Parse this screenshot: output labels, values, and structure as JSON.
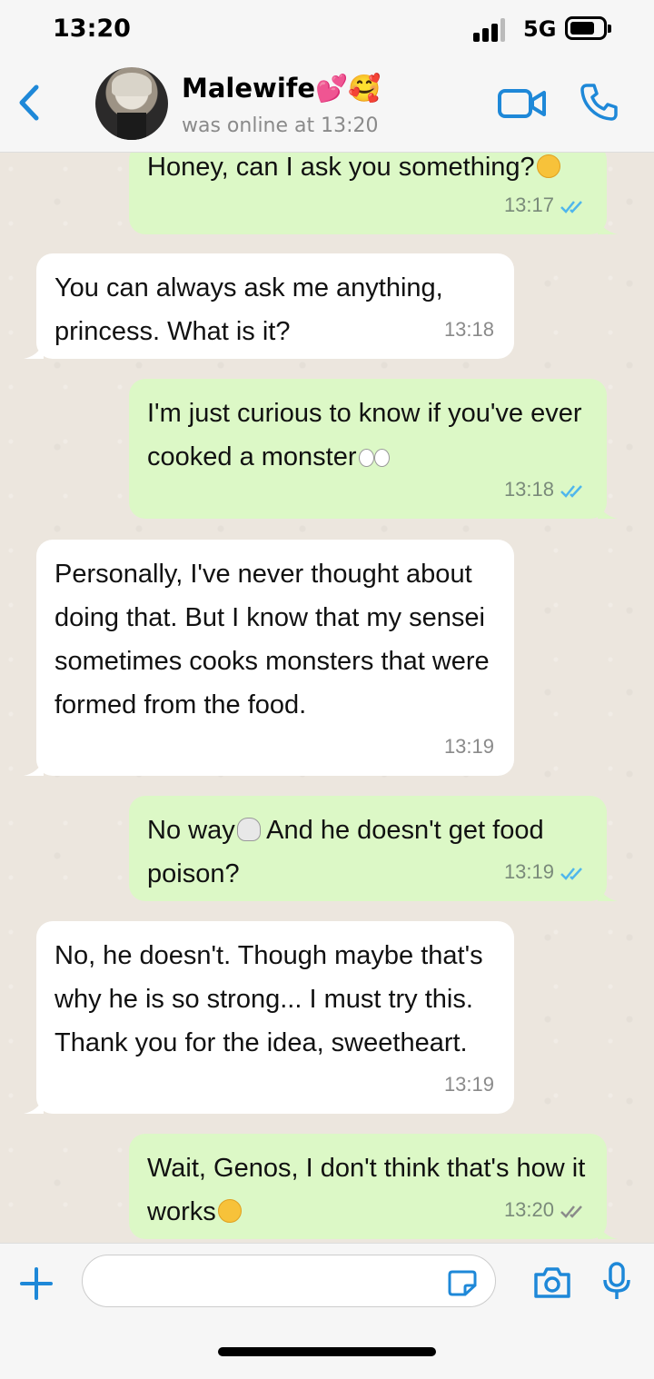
{
  "status_bar": {
    "time": "13:20",
    "network": "5G",
    "icons": [
      "signal-icon",
      "battery-icon"
    ]
  },
  "header": {
    "contact_name": "Malewife💕🥰",
    "contact_status": "was online at 13:20",
    "icons": [
      "back-icon",
      "video-call-icon",
      "phone-icon"
    ]
  },
  "messages": [
    {
      "direction": "out",
      "text": "Honey, can I ask you something?",
      "emoji": "🙃",
      "time": "13:17",
      "read": true
    },
    {
      "direction": "in",
      "text": "You can always ask me anything, princess. What is it?",
      "time": "13:18"
    },
    {
      "direction": "out",
      "text": "I'm just curious to know if you've ever cooked a monster",
      "emoji": "👀",
      "time": "13:18",
      "read": true
    },
    {
      "direction": "in",
      "text": "Personally, I've never thought about doing that. But I know that my sensei sometimes cooks monsters that were formed from the food.",
      "time": "13:19"
    },
    {
      "direction": "out",
      "text_before": "No way",
      "emoji": "💀",
      "text_after": " And he doesn't get food poison?",
      "time": "13:19",
      "read": true
    },
    {
      "direction": "in",
      "text": "No, he doesn't. Though maybe that's why he is so strong... I must try this. Thank you for the idea, sweetheart.",
      "time": "13:19"
    },
    {
      "direction": "out",
      "text": "Wait, Genos, I don't think that's how it works",
      "emoji": "😳",
      "time": "13:20",
      "read": false
    }
  ],
  "input_bar": {
    "placeholder": "",
    "icons": [
      "plus-icon",
      "sticker-icon",
      "camera-icon",
      "microphone-icon"
    ]
  },
  "colors": {
    "outgoing_bubble": "#dcf8c6",
    "incoming_bubble": "#ffffff",
    "accent": "#1e88d8",
    "read_tick": "#4fb6ec",
    "unread_tick": "#8a8a8a"
  }
}
